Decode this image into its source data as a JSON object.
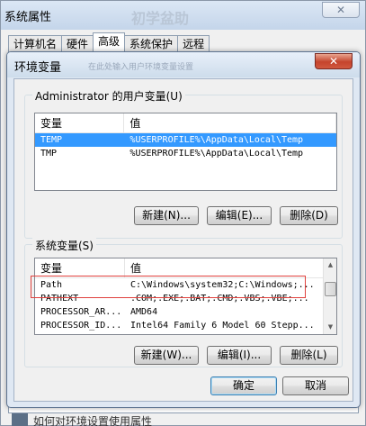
{
  "background_window": {
    "title": "系统属性",
    "title_ghost": "初学盆助",
    "close_label": "✕",
    "tabs": [
      {
        "label": "计算机名",
        "active": false
      },
      {
        "label": "硬件",
        "active": false
      },
      {
        "label": "高级",
        "active": true
      },
      {
        "label": "系统保护",
        "active": false
      },
      {
        "label": "远程",
        "active": false
      }
    ],
    "bottom_text": "如何对环境设置使用属性"
  },
  "dialog": {
    "title": "环境变量",
    "title_ghost": "在此处输入用户环境变量设置",
    "close_label": "✕",
    "user_vars": {
      "group_label": "Administrator 的用户变量(U)",
      "columns": [
        "变量",
        "值"
      ],
      "rows": [
        {
          "name": "TEMP",
          "value": "%USERPROFILE%\\AppData\\Local\\Temp",
          "selected": true
        },
        {
          "name": "TMP",
          "value": "%USERPROFILE%\\AppData\\Local\\Temp",
          "selected": false
        }
      ],
      "buttons": {
        "new": "新建(N)...",
        "edit": "编辑(E)...",
        "delete": "删除(D)"
      }
    },
    "system_vars": {
      "group_label": "系统变量(S)",
      "columns": [
        "变量",
        "值"
      ],
      "rows": [
        {
          "name": "Path",
          "value": "C:\\Windows\\system32;C:\\Windows;...",
          "highlighted": true
        },
        {
          "name": "PATHEXT",
          "value": ".COM;.EXE;.BAT;.CMD;.VBS;.VBE;...",
          "highlighted": false
        },
        {
          "name": "PROCESSOR_AR...",
          "value": "AMD64",
          "highlighted": false
        },
        {
          "name": "PROCESSOR_ID...",
          "value": "Intel64 Family 6 Model 60 Stepp...",
          "highlighted": false
        }
      ],
      "scroll_position": 0.3,
      "buttons": {
        "new": "新建(W)...",
        "edit": "编辑(I)...",
        "delete": "删除(L)"
      }
    },
    "ok_label": "确定",
    "cancel_label": "取消"
  },
  "colors": {
    "selection": "#3399ff",
    "highlight_box": "#e0423e",
    "close_button": "#c5442d"
  }
}
